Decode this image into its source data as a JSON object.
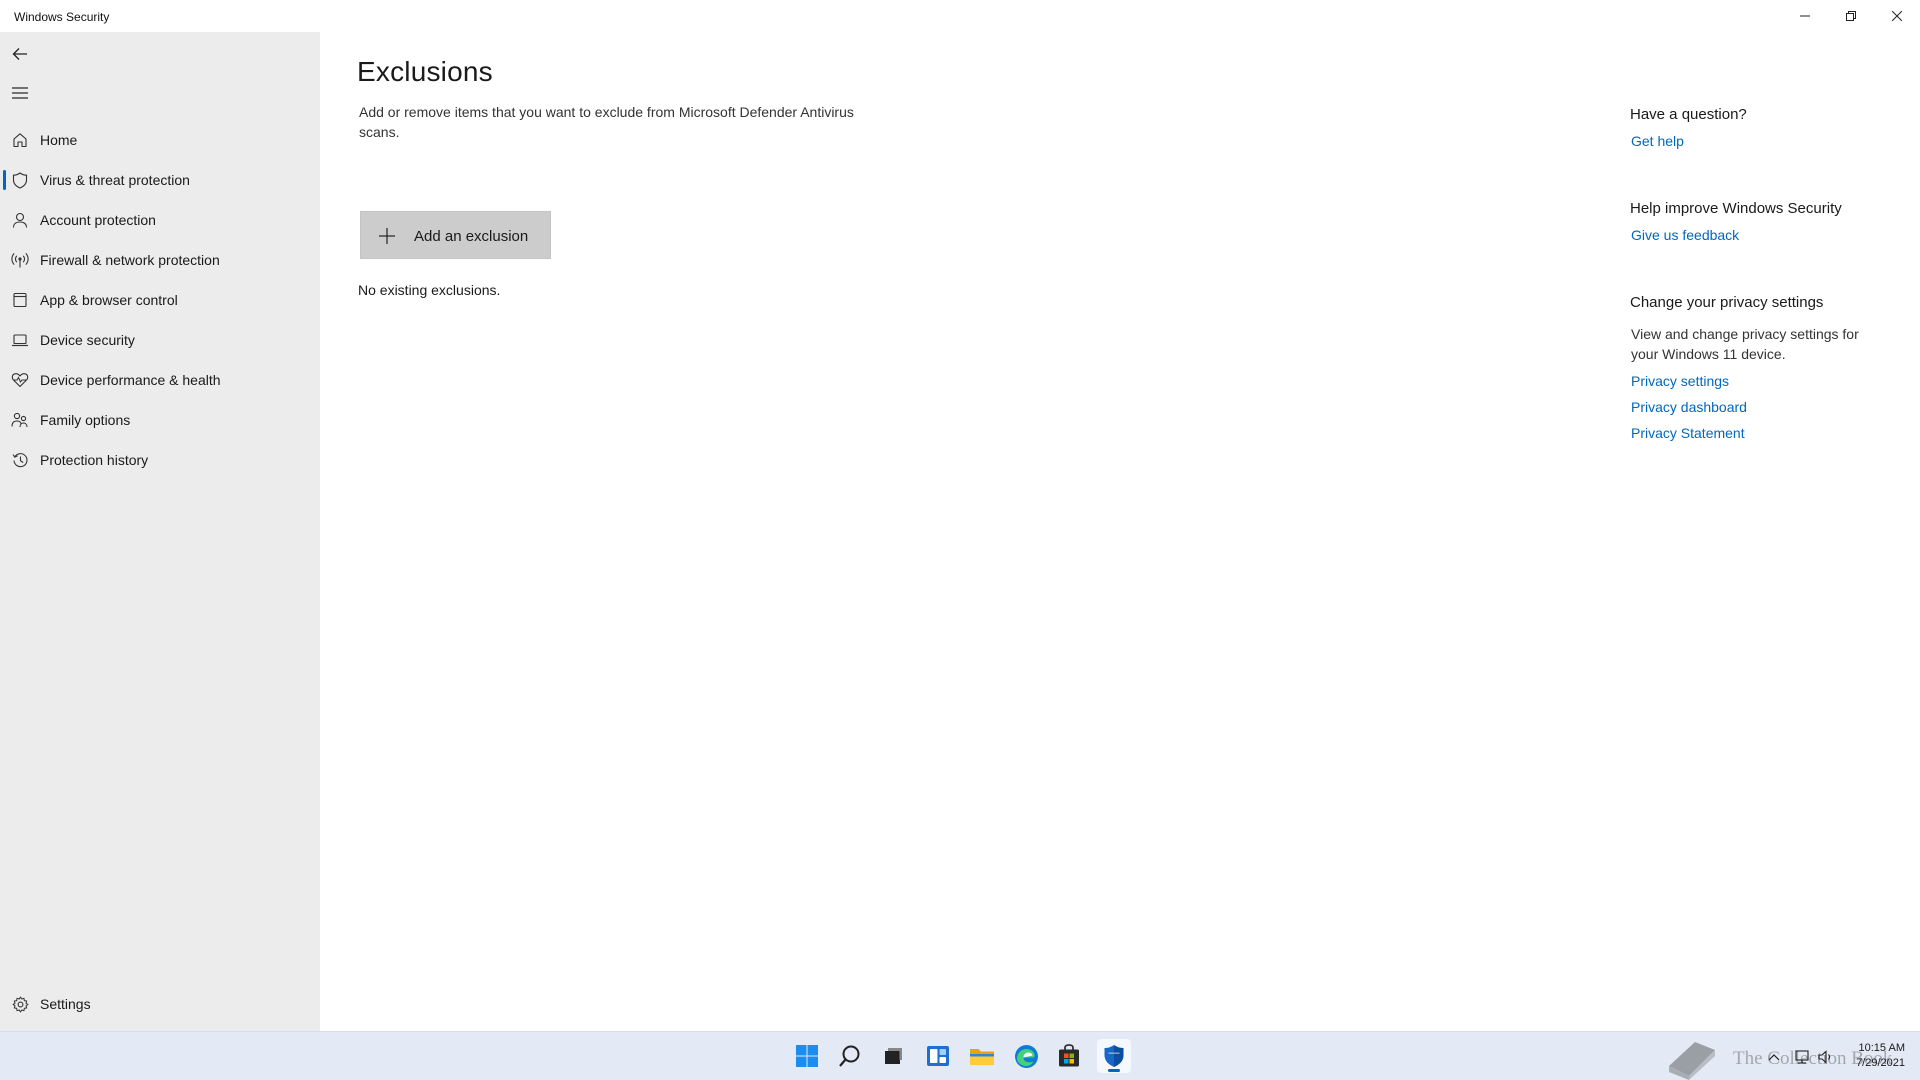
{
  "window": {
    "title": "Windows Security",
    "controls": [
      "minimize-icon",
      "restore-icon",
      "close-icon"
    ]
  },
  "sidebar": {
    "back_icon": "back-arrow-icon",
    "menu_icon": "hamburger-menu-icon",
    "items": [
      {
        "label": "Home",
        "icon": "home-icon"
      },
      {
        "label": "Virus & threat protection",
        "icon": "shield-icon",
        "active": true
      },
      {
        "label": "Account protection",
        "icon": "person-icon"
      },
      {
        "label": "Firewall & network protection",
        "icon": "antenna-icon"
      },
      {
        "label": "App & browser control",
        "icon": "app-window-icon"
      },
      {
        "label": "Device security",
        "icon": "laptop-icon"
      },
      {
        "label": "Device performance & health",
        "icon": "heart-pulse-icon"
      },
      {
        "label": "Family options",
        "icon": "family-icon"
      },
      {
        "label": "Protection history",
        "icon": "history-icon"
      }
    ],
    "settings": {
      "label": "Settings",
      "icon": "gear-icon"
    }
  },
  "main": {
    "title": "Exclusions",
    "description": "Add or remove items that you want to exclude from Microsoft Defender Antivirus scans.",
    "add_button": "Add an exclusion",
    "empty_text": "No existing exclusions."
  },
  "right_panel": {
    "question_heading": "Have a question?",
    "get_help": "Get help",
    "improve_heading": "Help improve Windows Security",
    "feedback": "Give us feedback",
    "privacy_heading": "Change your privacy settings",
    "privacy_text": "View and change privacy settings for your Windows 11 device.",
    "privacy_settings": "Privacy settings",
    "privacy_dashboard": "Privacy dashboard",
    "privacy_statement": "Privacy Statement"
  },
  "taskbar": {
    "apps": [
      "start-icon",
      "search-icon",
      "task-view-icon",
      "widgets-icon",
      "file-explorer-icon",
      "edge-icon",
      "store-icon",
      "windows-security-icon"
    ],
    "active_app": "windows-security-icon",
    "time": "10:15 AM",
    "date": "7/29/2021",
    "watermark": "The Collection Book"
  },
  "colors": {
    "accent": "#0067c0",
    "sidebar_bg": "#ececec",
    "button_bg": "#cccccc",
    "taskbar_bg": "#e3eaf6"
  }
}
